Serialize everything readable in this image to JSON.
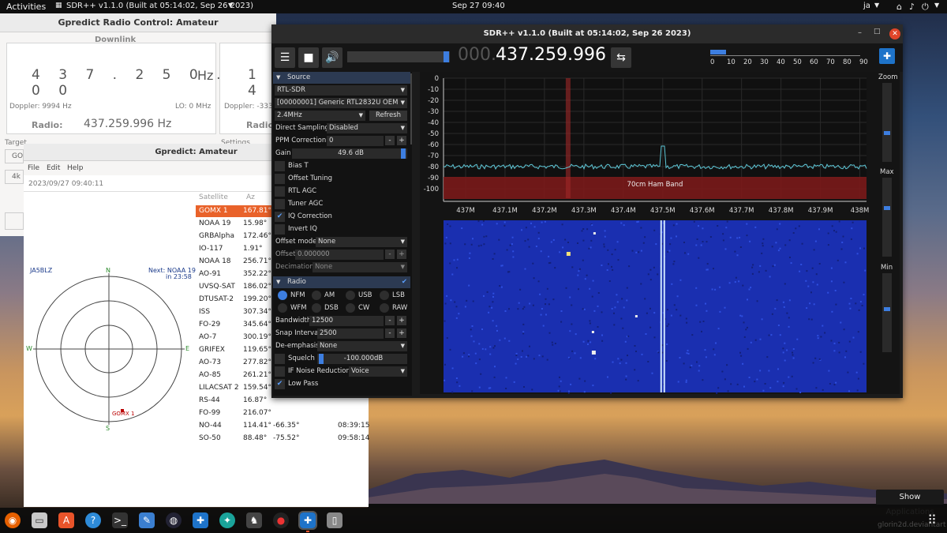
{
  "topbar": {
    "activities": "Activities",
    "app": "SDR++ v1.1.0 (Built at 05:14:02, Sep 26 2023)",
    "clock": "Sep 27  09:40",
    "user": "ja"
  },
  "radio_ctl": {
    "title": "Gpredict Radio Control: Amateur",
    "downlink": "Downlink",
    "digits": "4 3 7 . 2 5 0 . 0 0 0",
    "unit": "Hz",
    "doppler": "Doppler: 9994 Hz",
    "lo": "LO: 0 MHz",
    "radio_label": "Radio:",
    "radio_freq": "437.259.996 Hz",
    "digits2": "1 4",
    "doppler2": "Doppler: -333",
    "radio_label2": "Radio:",
    "target": "Target",
    "settings": "Settings",
    "go": "GO",
    "k4": "4k"
  },
  "amateur": {
    "title": "Gpredict: Amateur",
    "menu": {
      "file": "File",
      "edit": "Edit",
      "help": "Help"
    },
    "datetime": "2023/09/27 09:40:11",
    "callsign": "JA5BLZ",
    "next_line1": "Next: NOAA 19",
    "next_line2": "in 23:58",
    "compass": {
      "n": "N",
      "s": "S",
      "e": "E",
      "w": "W"
    },
    "sat_marker": "GOMX 1",
    "headers": {
      "sat": "Satellite",
      "az": "Az"
    },
    "rows": [
      {
        "name": "GOMX 1",
        "az": "167.81°"
      },
      {
        "name": "NOAA 19",
        "az": "15.98°"
      },
      {
        "name": "GRBAlpha",
        "az": "172.46°"
      },
      {
        "name": "IO-117",
        "az": "1.91°"
      },
      {
        "name": "NOAA 18",
        "az": "256.71°"
      },
      {
        "name": "AO-91",
        "az": "352.22°"
      },
      {
        "name": "UVSQ-SAT",
        "az": "186.02°"
      },
      {
        "name": "DTUSAT-2",
        "az": "199.20°"
      },
      {
        "name": "ISS",
        "az": "307.34°"
      },
      {
        "name": "FO-29",
        "az": "345.64°"
      },
      {
        "name": "AO-7",
        "az": "300.19°"
      },
      {
        "name": "GRIFEX",
        "az": "119.65°"
      },
      {
        "name": "AO-73",
        "az": "277.82°"
      },
      {
        "name": "AO-85",
        "az": "261.21°"
      },
      {
        "name": "LILACSAT 2",
        "az": "159.54°"
      },
      {
        "name": "RS-44",
        "az": "16.87°"
      },
      {
        "name": "FO-99",
        "az": "216.07°"
      },
      {
        "name": "NO-44",
        "az": "114.41°",
        "el": "-66.35°",
        "time": "08:39:15"
      },
      {
        "name": "SO-50",
        "az": "88.48°",
        "el": "-75.52°",
        "time": "09:58:14"
      }
    ]
  },
  "sdr": {
    "title": "SDR++ v1.1.0 (Built at 05:14:02, Sep 26 2023)",
    "freq_dim": "000.",
    "freq_main": "437.259.996",
    "scale": [
      "0",
      "10",
      "20",
      "30",
      "40",
      "50",
      "60",
      "70",
      "80",
      "90"
    ],
    "zoom": "Zoom",
    "max": "Max",
    "min": "Min",
    "zoom_level": 0.36,
    "max_level": 0.62,
    "min_level": 0.55,
    "source": {
      "header": "Source",
      "device_type": "RTL-SDR",
      "device": "[00000001] Generic RTL2832U OEM",
      "samplerate": "2.4MHz",
      "refresh": "Refresh",
      "direct_sampling": "Direct Sampling",
      "direct_sampling_val": "Disabled",
      "ppm": "PPM Correction",
      "ppm_val": "0",
      "gain": "Gain",
      "gain_val": "49.6 dB",
      "bias_t": "Bias T",
      "offset_tuning": "Offset Tuning",
      "rtl_agc": "RTL AGC",
      "tuner_agc": "Tuner AGC",
      "iq": "IQ Correction",
      "invert_iq": "Invert IQ",
      "offset_mode": "Offset mode",
      "offset_mode_val": "None",
      "offset": "Offset",
      "offset_val": "0.000000",
      "decimation": "Decimation",
      "decimation_val": "None"
    },
    "radio": {
      "header": "Radio",
      "modes": [
        "NFM",
        "AM",
        "USB",
        "LSB",
        "WFM",
        "DSB",
        "CW",
        "RAW"
      ],
      "bandwidth": "Bandwidth",
      "bandwidth_val": "12500",
      "snap": "Snap Interval",
      "snap_val": "2500",
      "deemph": "De-emphasis",
      "deemph_val": "None",
      "squelch": "Squelch",
      "squelch_val": "-100.000dB",
      "ifnr": "IF Noise Reduction",
      "ifnr_val": "Voice",
      "lowpass": "Low Pass"
    },
    "spectrum": {
      "y_ticks": [
        "0",
        "-10",
        "-20",
        "-30",
        "-40",
        "-50",
        "-60",
        "-70",
        "-80",
        "-90",
        "-100"
      ],
      "x_ticks": [
        "437M",
        "437.1M",
        "437.2M",
        "437.3M",
        "437.4M",
        "437.5M",
        "437.6M",
        "437.7M",
        "437.8M",
        "437.9M",
        "438M"
      ],
      "band_label": "70cm Ham Band"
    }
  },
  "desktop": {
    "show_apps": "Show Applications",
    "watermark": "glorin2d.deviantart"
  }
}
